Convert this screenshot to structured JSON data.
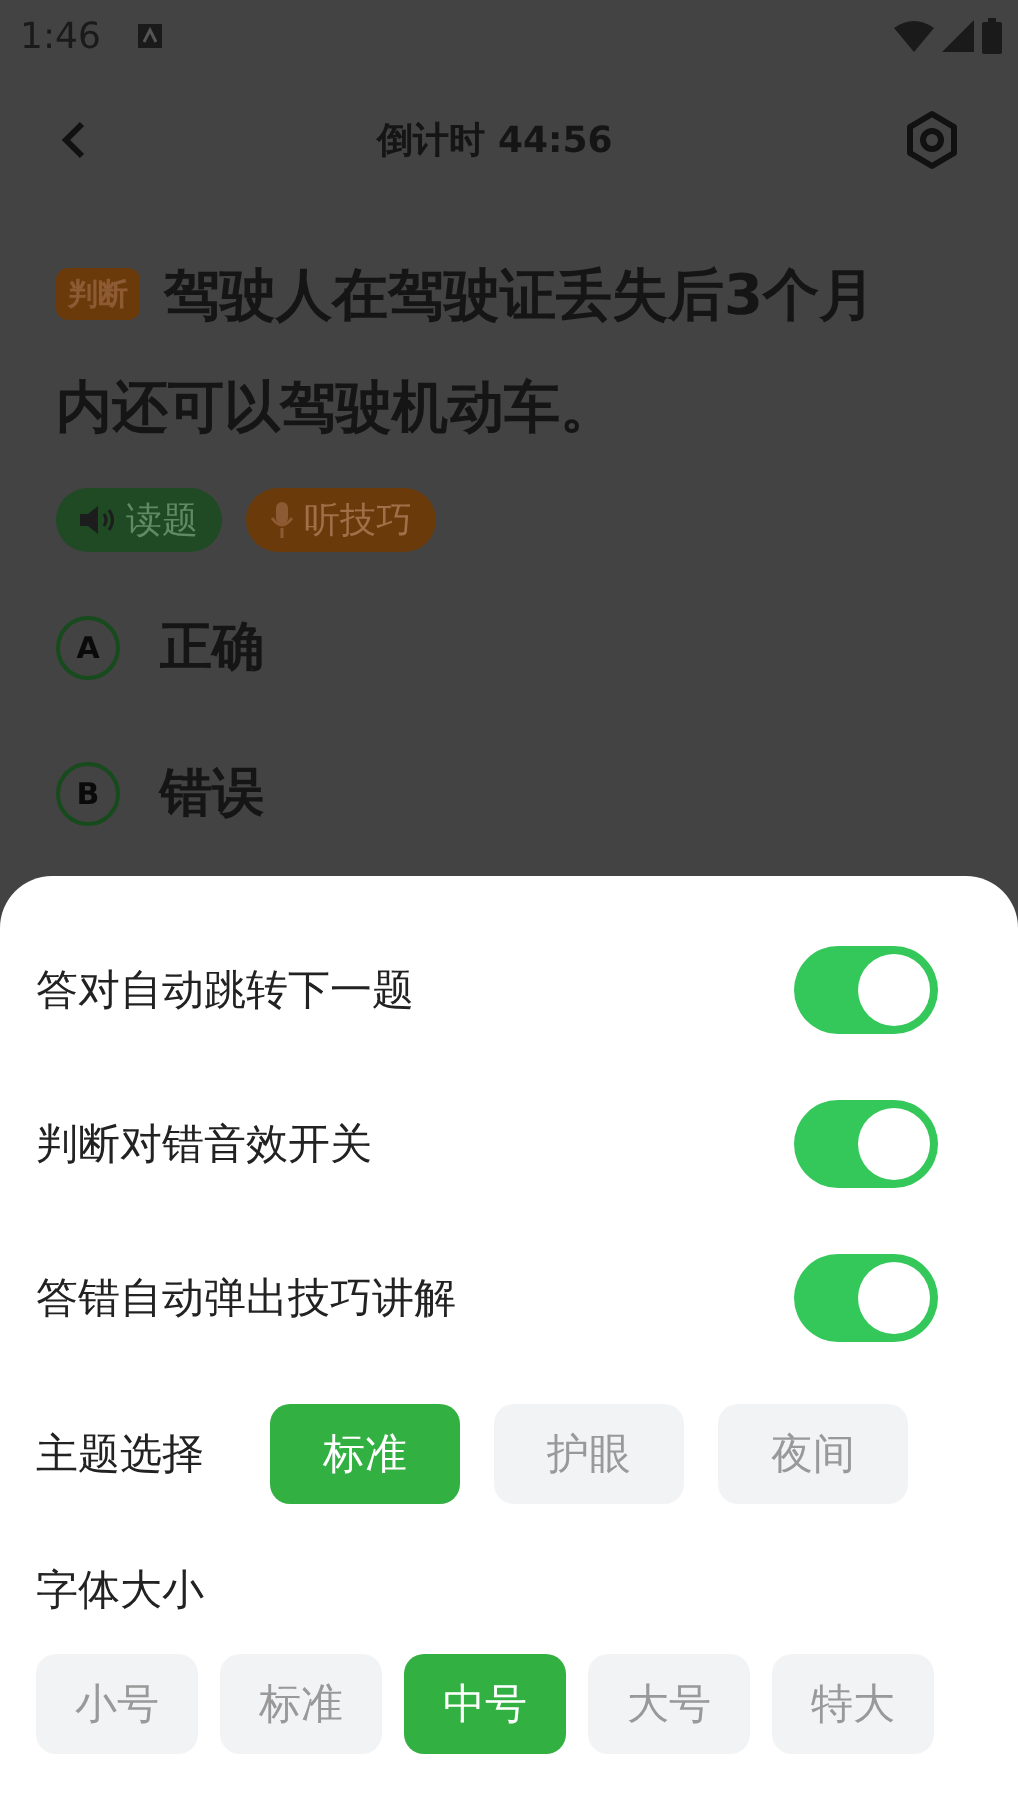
{
  "status_bar": {
    "time": "1:46"
  },
  "header": {
    "title": "倒计时 44:56"
  },
  "question": {
    "type_tag": "判断",
    "text": "驾驶人在驾驶证丢失后3个月内还可以驾驶机动车。"
  },
  "actions": [
    {
      "kind": "read",
      "label": "读题"
    },
    {
      "kind": "listen",
      "label": "听技巧"
    }
  ],
  "options": [
    {
      "letter": "A",
      "text": "正确"
    },
    {
      "letter": "B",
      "text": "错误"
    }
  ],
  "settings": {
    "toggles": [
      {
        "label": "答对自动跳转下一题",
        "on": true
      },
      {
        "label": "判断对错音效开关",
        "on": true
      },
      {
        "label": "答错自动弹出技巧讲解",
        "on": true
      }
    ],
    "theme": {
      "label": "主题选择",
      "choices": [
        {
          "label": "标准",
          "selected": true
        },
        {
          "label": "护眼",
          "selected": false
        },
        {
          "label": "夜间",
          "selected": false
        }
      ]
    },
    "font_size": {
      "label": "字体大小",
      "choices": [
        {
          "label": "小号",
          "selected": false
        },
        {
          "label": "标准",
          "selected": false
        },
        {
          "label": "中号",
          "selected": true
        },
        {
          "label": "大号",
          "selected": false
        },
        {
          "label": "特大",
          "selected": false
        }
      ]
    }
  }
}
